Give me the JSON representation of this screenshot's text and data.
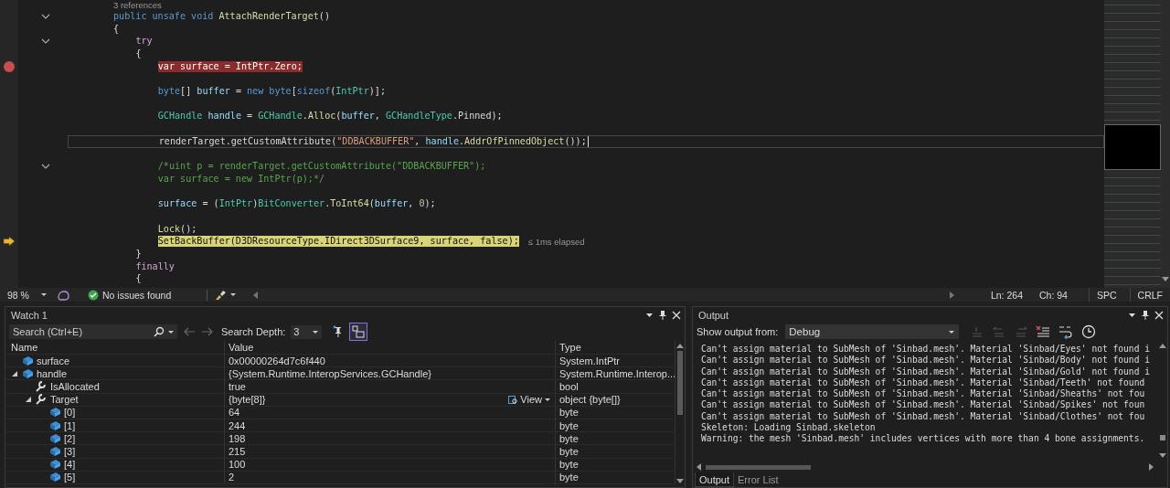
{
  "editor": {
    "lines": [
      {
        "kind": "codelens",
        "fold": false,
        "text": "3 references"
      },
      {
        "kind": "normal",
        "fold": true,
        "tokens": [
          {
            "kind": "keyword",
            "text": "public unsafe void"
          },
          {
            "kind": "method",
            "text": " AttachRenderTarget"
          },
          {
            "kind": "plain",
            "text": "()"
          }
        ]
      },
      {
        "kind": "normal",
        "fold": false,
        "tokens": [
          {
            "kind": "plain",
            "text": "{"
          }
        ],
        "children": [
          {
            "kind": "normal",
            "fold": true,
            "tokens": [
              {
                "kind": "control",
                "text": "try"
              }
            ]
          },
          {
            "kind": "normal",
            "fold": false,
            "tokens": [
              {
                "kind": "plain",
                "text": "{"
              }
            ],
            "children": [
              {
                "kind": "breakpoint",
                "fold": false,
                "tokens": [
                  {
                    "kind": "plain",
                    "text": "var surface = IntPtr.Zero;"
                  }
                ]
              },
              {
                "kind": "blank",
                "fold": false
              },
              {
                "kind": "normal",
                "fold": false,
                "tokens": [
                  {
                    "kind": "keyword",
                    "text": "byte"
                  },
                  {
                    "kind": "plain",
                    "text": "[] "
                  },
                  {
                    "kind": "variable",
                    "text": "buffer"
                  },
                  {
                    "kind": "plain",
                    "text": " = "
                  },
                  {
                    "kind": "keyword",
                    "text": "new byte"
                  },
                  {
                    "kind": "plain",
                    "text": "["
                  },
                  {
                    "kind": "keyword",
                    "text": "sizeof"
                  },
                  {
                    "kind": "plain",
                    "text": "("
                  },
                  {
                    "kind": "type",
                    "text": "IntPtr"
                  },
                  {
                    "kind": "plain",
                    "text": ")];"
                  }
                ]
              },
              {
                "kind": "blank",
                "fold": false
              },
              {
                "kind": "normal",
                "fold": false,
                "tokens": [
                  {
                    "kind": "type",
                    "text": "GCHandle"
                  },
                  {
                    "kind": "variable",
                    "text": " handle"
                  },
                  {
                    "kind": "plain",
                    "text": " = "
                  },
                  {
                    "kind": "type",
                    "text": "GCHandle"
                  },
                  {
                    "kind": "plain",
                    "text": "."
                  },
                  {
                    "kind": "method",
                    "text": "Alloc"
                  },
                  {
                    "kind": "plain",
                    "text": "("
                  },
                  {
                    "kind": "variable",
                    "text": "buffer"
                  },
                  {
                    "kind": "plain",
                    "text": ", "
                  },
                  {
                    "kind": "type",
                    "text": "GCHandleType"
                  },
                  {
                    "kind": "plain",
                    "text": ".Pinned);"
                  }
                ]
              },
              {
                "kind": "blank",
                "fold": false
              },
              {
                "kind": "cursor",
                "fold": false,
                "tokens": [
                  {
                    "kind": "plain",
                    "text": "renderTarget.getCustomAttribute("
                  },
                  {
                    "kind": "string",
                    "text": "\"DDBACKBUFFER\""
                  },
                  {
                    "kind": "plain",
                    "text": ", "
                  },
                  {
                    "kind": "variable",
                    "text": "handle"
                  },
                  {
                    "kind": "plain",
                    "text": "."
                  },
                  {
                    "kind": "method",
                    "text": "AddrOfPinnedObject"
                  },
                  {
                    "kind": "plain",
                    "text": "());"
                  }
                ]
              },
              {
                "kind": "blank",
                "fold": false
              },
              {
                "kind": "normal",
                "fold": true,
                "tokens": [
                  {
                    "kind": "comment",
                    "text": "/*uint p = renderTarget.getCustomAttribute(\"DDBACKBUFFER\");"
                  }
                ]
              },
              {
                "kind": "normal",
                "fold": false,
                "tokens": [
                  {
                    "kind": "comment",
                    "text": "var surface = new IntPtr(p);*/"
                  }
                ]
              },
              {
                "kind": "blank",
                "fold": false
              },
              {
                "kind": "normal",
                "fold": false,
                "tokens": [
                  {
                    "kind": "variable",
                    "text": "surface"
                  },
                  {
                    "kind": "plain",
                    "text": " = ("
                  },
                  {
                    "kind": "type",
                    "text": "IntPtr"
                  },
                  {
                    "kind": "plain",
                    "text": ")"
                  },
                  {
                    "kind": "type",
                    "text": "BitConverter"
                  },
                  {
                    "kind": "plain",
                    "text": "."
                  },
                  {
                    "kind": "method",
                    "text": "ToInt64"
                  },
                  {
                    "kind": "plain",
                    "text": "("
                  },
                  {
                    "kind": "variable",
                    "text": "buffer"
                  },
                  {
                    "kind": "plain",
                    "text": ", "
                  },
                  {
                    "kind": "number",
                    "text": "0"
                  },
                  {
                    "kind": "plain",
                    "text": ");"
                  }
                ]
              },
              {
                "kind": "blank",
                "fold": false
              },
              {
                "kind": "normal",
                "fold": false,
                "tokens": [
                  {
                    "kind": "method",
                    "text": "Lock"
                  },
                  {
                    "kind": "plain",
                    "text": "();"
                  }
                ]
              },
              {
                "kind": "current",
                "fold": false,
                "tip": "≤ 1ms elapsed",
                "tokens": [
                  {
                    "kind": "plain",
                    "text": "SetBackBuffer(D3DResourceType.IDirect3DSurface9, surface, false);"
                  }
                ]
              }
            ]
          },
          {
            "kind": "normal",
            "fold": false,
            "tokens": [
              {
                "kind": "plain",
                "text": "}"
              }
            ]
          },
          {
            "kind": "normal",
            "fold": false,
            "tokens": [
              {
                "kind": "control",
                "text": "finally"
              }
            ]
          },
          {
            "kind": "normal",
            "fold": false,
            "tokens": [
              {
                "kind": "plain",
                "text": "{"
              }
            ]
          }
        ]
      }
    ],
    "status": {
      "zoom": "98 %",
      "issues": "No issues found",
      "line": "Ln: 264",
      "column": "Ch: 94",
      "whitespace": "SPC",
      "line_ending": "CRLF"
    }
  },
  "watch": {
    "title": "Watch 1",
    "search": {
      "placeholder": "Search (Ctrl+E)"
    },
    "depth_label": "Search Depth:",
    "depth": "3",
    "columns": [
      "Name",
      "Value",
      "Type"
    ],
    "rows": [
      {
        "name": "surface",
        "kind": "field",
        "value": "0x00000264d7c6f440",
        "type": "System.IntPtr"
      },
      {
        "name": "handle",
        "kind": "field",
        "value": "{System.Runtime.InteropServices.GCHandle}",
        "type": "System.Runtime.Interop...",
        "expanded": true,
        "children": [
          {
            "name": "IsAllocated",
            "kind": "property",
            "value": "true",
            "type": "bool"
          },
          {
            "name": "Target",
            "kind": "property",
            "value": "{byte[8]}",
            "type": "object {byte[]}",
            "view": "View",
            "expanded": true,
            "children": [
              {
                "name": "[0]",
                "kind": "field",
                "value": "64",
                "type": "byte"
              },
              {
                "name": "[1]",
                "kind": "field",
                "value": "244",
                "type": "byte"
              },
              {
                "name": "[2]",
                "kind": "field",
                "value": "198",
                "type": "byte"
              },
              {
                "name": "[3]",
                "kind": "field",
                "value": "215",
                "type": "byte"
              },
              {
                "name": "[4]",
                "kind": "field",
                "value": "100",
                "type": "byte"
              },
              {
                "name": "[5]",
                "kind": "field",
                "value": "2",
                "type": "byte"
              }
            ]
          }
        ]
      }
    ]
  },
  "output": {
    "title": "Output",
    "source_label": "Show output from:",
    "source": "Debug",
    "lines": [
      "Can't assign material to SubMesh of 'Sinbad.mesh'. Material 'Sinbad/Eyes' not found i",
      "Can't assign material to SubMesh of 'Sinbad.mesh'. Material 'Sinbad/Body' not found i",
      "Can't assign material to SubMesh of 'Sinbad.mesh'. Material 'Sinbad/Gold' not found i",
      "Can't assign material to SubMesh of 'Sinbad.mesh'. Material 'Sinbad/Teeth' not found",
      "Can't assign material to SubMesh of 'Sinbad.mesh'. Material 'Sinbad/Sheaths' not fou",
      "Can't assign material to SubMesh of 'Sinbad.mesh'. Material 'Sinbad/Spikes' not foun",
      "Can't assign material to SubMesh of 'Sinbad.mesh'. Material 'Sinbad/Clothes' not fou",
      "Skeleton: Loading Sinbad.skeleton",
      "Warning: the mesh 'Sinbad.mesh' includes vertices with more than 4 bone assignments."
    ],
    "tabs": [
      {
        "label": "Output",
        "selected": true
      },
      {
        "label": "Error List",
        "selected": false
      }
    ]
  }
}
